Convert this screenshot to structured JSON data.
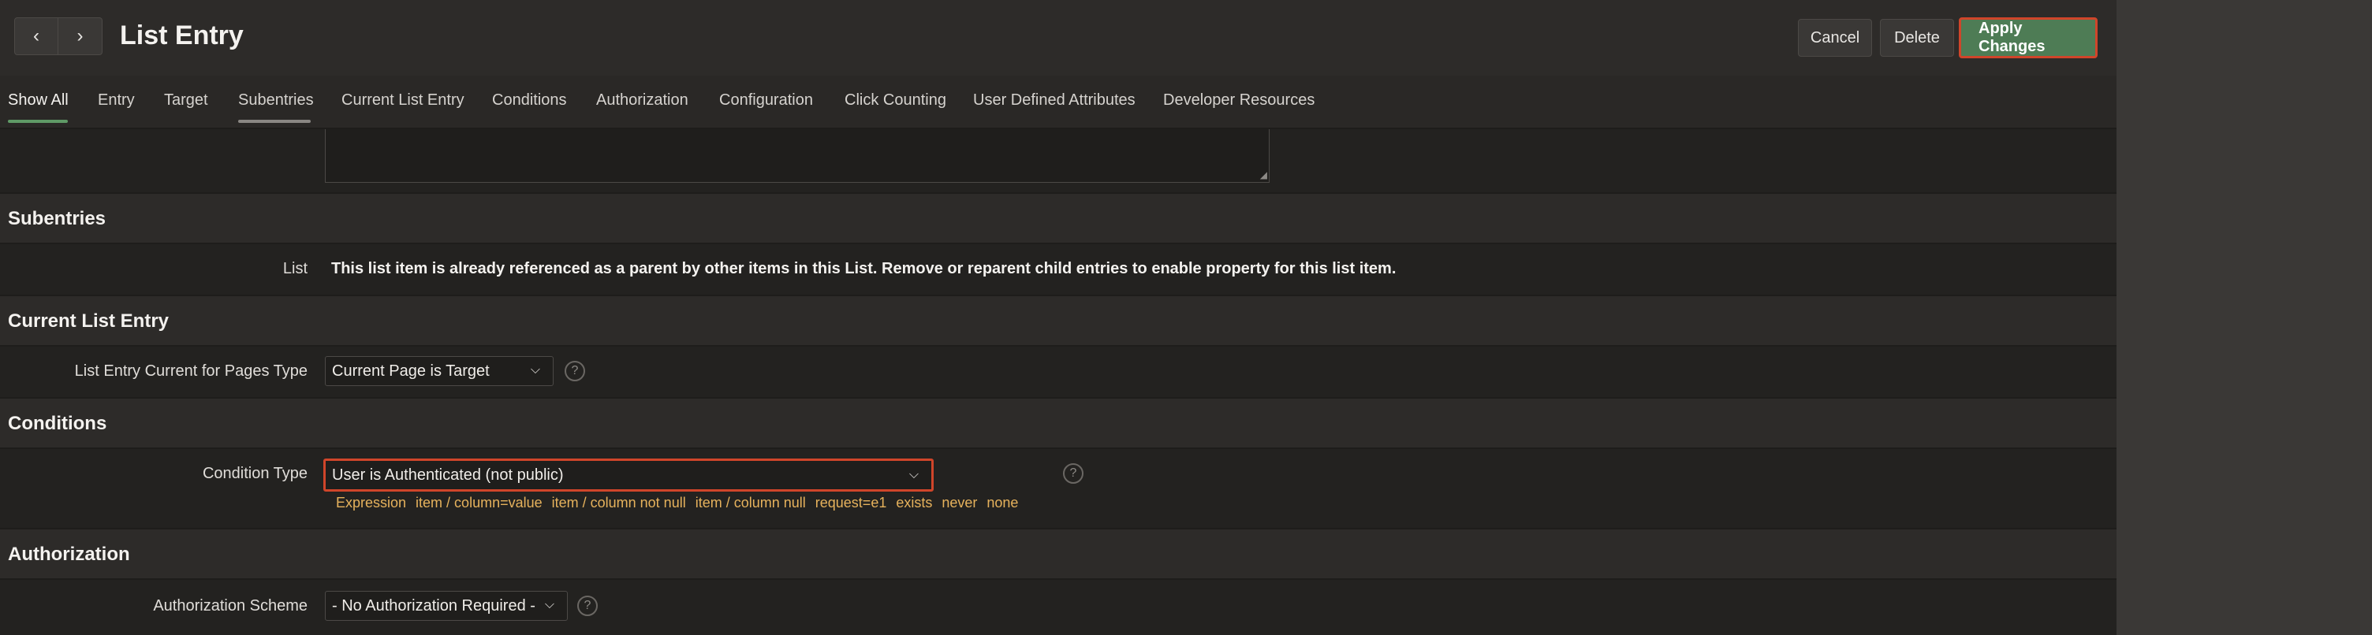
{
  "header": {
    "title": "List Entry",
    "prev_icon": "chevron-left-icon",
    "next_icon": "chevron-right-icon",
    "prev_glyph": "‹",
    "next_glyph": "›",
    "cancel_label": "Cancel",
    "delete_label": "Delete",
    "apply_label": "Apply Changes"
  },
  "tabs": [
    {
      "label": "Show All",
      "active": true
    },
    {
      "label": "Entry"
    },
    {
      "label": "Target"
    },
    {
      "label": "Subentries",
      "hover": true
    },
    {
      "label": "Current List Entry"
    },
    {
      "label": "Conditions"
    },
    {
      "label": "Authorization"
    },
    {
      "label": "Configuration"
    },
    {
      "label": "Click Counting"
    },
    {
      "label": "User Defined Attributes"
    },
    {
      "label": "Developer Resources"
    }
  ],
  "sections": {
    "subentries": {
      "title": "Subentries",
      "list_label": "List",
      "list_message": "This list item is already referenced as a parent by other items in this List. Remove or reparent child entries to enable property for this list item."
    },
    "current_list_entry": {
      "title": "Current List Entry",
      "pages_type_label": "List Entry Current for Pages Type",
      "pages_type_value": "Current Page is Target"
    },
    "conditions": {
      "title": "Conditions",
      "condition_type_label": "Condition Type",
      "condition_type_value": "User is Authenticated (not public)",
      "quick_picks": [
        "Expression",
        "item / column=value",
        "item / column not null",
        "item / column null",
        "request=e1",
        "exists",
        "never",
        "none"
      ]
    },
    "authorization": {
      "title": "Authorization",
      "scheme_label": "Authorization Scheme",
      "scheme_value": "- No Authorization Required -"
    }
  },
  "help_glyph": "?",
  "chevron_glyph": "⌵",
  "colors": {
    "apply_bg": "#4e7c55",
    "highlight_border": "#d0452a",
    "active_tab_underline": "#5f9a66",
    "hover_tab_underline": "#8a8783",
    "quick_pick": "#e6b25c"
  }
}
